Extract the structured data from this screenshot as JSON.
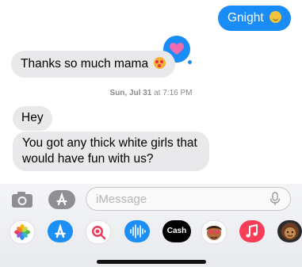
{
  "thread": {
    "messages": [
      {
        "direction": "outgoing",
        "text": "Gnight",
        "emoji": "smiling-face-emoji"
      },
      {
        "direction": "incoming",
        "text": "Thanks so much mama",
        "emoji": "face-blowing-kiss-emoji",
        "reaction": "heart"
      },
      {
        "direction": "incoming",
        "text": "Hey"
      },
      {
        "direction": "incoming",
        "text": "You got any thick white girls that would have fun with us?"
      }
    ],
    "timestamp": {
      "date": "Sun, Jul 31",
      "time": "at 7:16 PM"
    }
  },
  "compose": {
    "placeholder": "iMessage",
    "camera_icon": "camera-icon",
    "apps_icon": "app-store-icon",
    "mic_icon": "microphone-icon"
  },
  "app_drawer": {
    "apps": [
      {
        "name": "photos",
        "icon": "photos-icon"
      },
      {
        "name": "app-store",
        "icon": "app-store-icon"
      },
      {
        "name": "search",
        "icon": "image-search-icon"
      },
      {
        "name": "audio",
        "icon": "waveform-icon"
      },
      {
        "name": "cash",
        "label": "Cash"
      },
      {
        "name": "memoji",
        "icon": "memoji-icon"
      },
      {
        "name": "music",
        "icon": "music-note-icon"
      },
      {
        "name": "memoji-stickers",
        "icon": "memoji-sticker-icon"
      }
    ]
  },
  "colors": {
    "outgoing_bubble": "#1a8cf7",
    "incoming_bubble": "#e9e9eb",
    "reaction_heart": "#f06bb0"
  }
}
